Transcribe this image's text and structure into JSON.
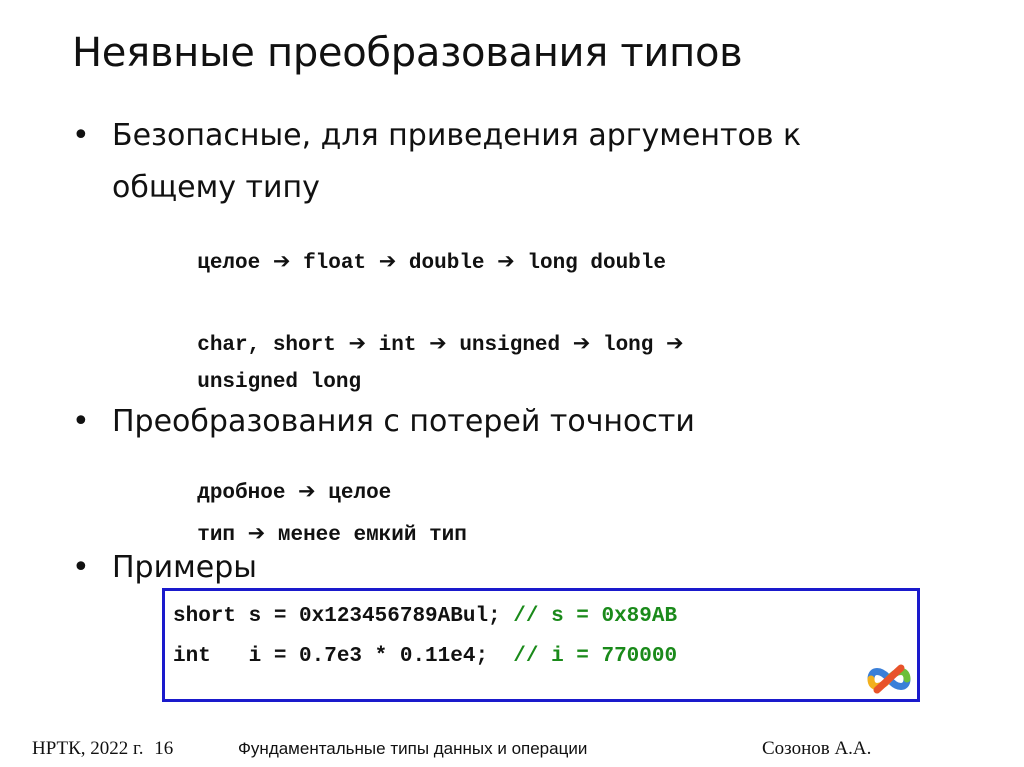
{
  "slide": {
    "title": "Неявные преобразования типов",
    "bullets": [
      {
        "text_line1": "Безопасные, для приведения аргументов к",
        "text_line2": "общему типу",
        "code": [
          {
            "parts": [
              "целое",
              "float",
              "double",
              "long double"
            ]
          },
          {
            "parts": [
              "char, short",
              "int",
              "unsigned",
              "long",
              ""
            ]
          },
          {
            "parts": [
              "unsigned long"
            ]
          }
        ]
      },
      {
        "text_line1": "Преобразования с потерей точности",
        "code": [
          {
            "parts": [
              "дробное",
              "целое"
            ]
          },
          {
            "parts": [
              "тип",
              "менее емкий тип"
            ]
          }
        ]
      },
      {
        "text_line1": "Примеры"
      }
    ],
    "bullet_symbol": "•",
    "arrow_symbol": "➔",
    "example_box": {
      "lines": [
        {
          "code": "short s = 0x123456789ABul; ",
          "comment": "// s = 0x89AB"
        },
        {
          "code": "int   i = 0.7e3 * 0.11e4;  ",
          "comment": "// i = 770000"
        }
      ],
      "border_color": "#1a1acc",
      "comment_color": "#1a8a1a",
      "logo_icon": "visual-studio-logo"
    }
  },
  "footer": {
    "left": "НРТК, 2022 г.",
    "page_number": "16",
    "center": "Фундаментальные типы данных и операции",
    "right": "Созонов А.А."
  }
}
